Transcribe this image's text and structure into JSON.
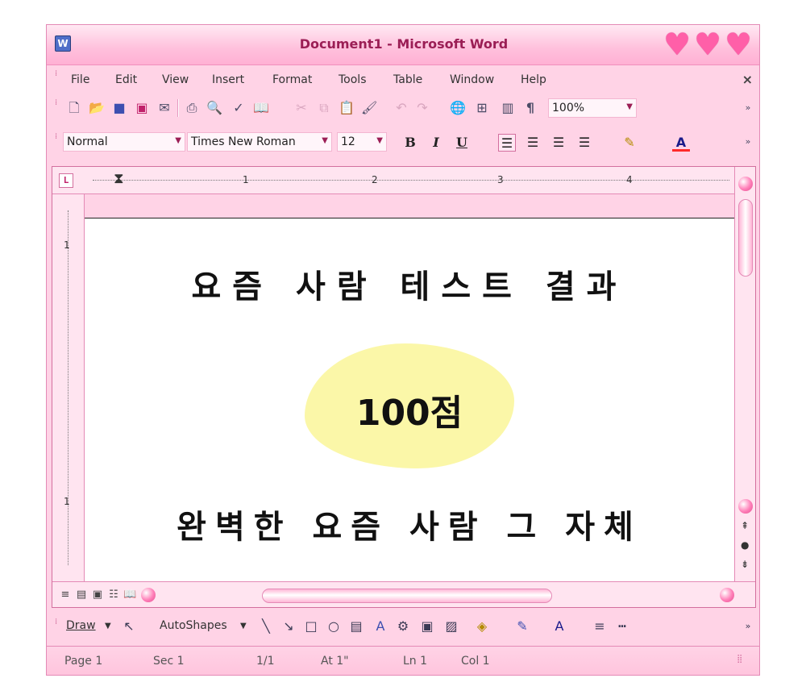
{
  "window": {
    "title": "Document1 - Microsoft Word",
    "app_icon": "W"
  },
  "menu": {
    "items": [
      "File",
      "Edit",
      "View",
      "Insert",
      "Format",
      "Tools",
      "Table",
      "Window",
      "Help"
    ],
    "close": "×"
  },
  "toolbar_standard": {
    "zoom": "100%"
  },
  "toolbar_format": {
    "style": "Normal",
    "font": "Times New Roman",
    "size": "12",
    "bold": "B",
    "italic": "I",
    "underline": "U"
  },
  "ruler": {
    "h_numbers": [
      "1",
      "2",
      "3",
      "4"
    ],
    "v_numbers": [
      "1",
      "1"
    ]
  },
  "document": {
    "title": "요즘 사람 테스트 결과",
    "score": "100점",
    "subtitle": "완벽한 요즘 사람 그 자체"
  },
  "draw_toolbar": {
    "draw": "Draw",
    "autoshapes": "AutoShapes"
  },
  "status": {
    "page": "Page 1",
    "sec": "Sec 1",
    "pages": "1/1",
    "at": "At 1\"",
    "ln": "Ln 1",
    "col": "Col 1"
  },
  "colors": {
    "chrome_pink": "#ffd3e6",
    "title_text": "#9b1e55",
    "heart": "#ff5fa8",
    "score_highlight": "#fbf7a8"
  },
  "icons": [
    "new-document-icon",
    "open-folder-icon",
    "save-icon",
    "print-icon",
    "spelling-icon",
    "paste-icon",
    "format-painter-icon",
    "hyperlink-icon",
    "pilcrow-icon",
    "highlight-icon",
    "font-color-icon",
    "heart-icon"
  ]
}
